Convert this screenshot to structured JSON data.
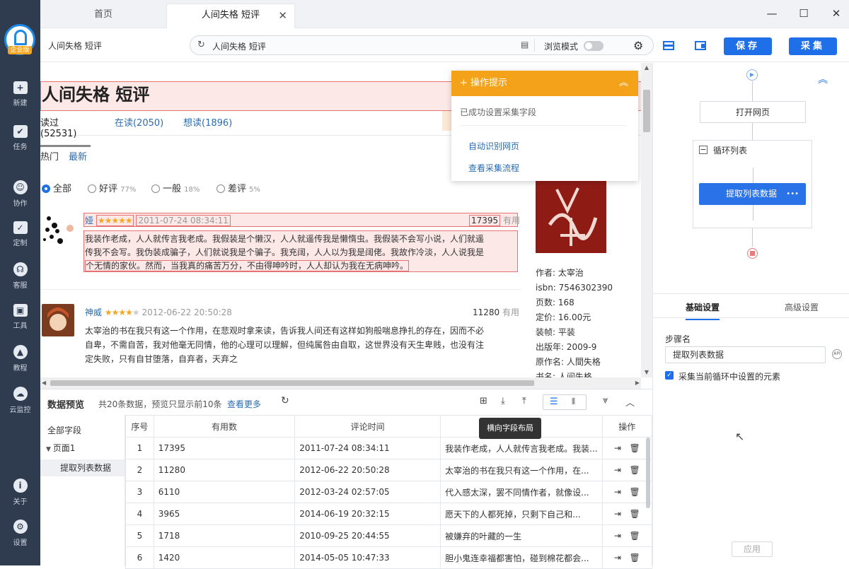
{
  "sidebar": {
    "logo_tag": "企业版",
    "items": [
      {
        "label": "新建",
        "icon": "plus-icon",
        "glyph": "+"
      },
      {
        "label": "任务",
        "icon": "flag-icon",
        "glyph": "✔"
      },
      {
        "label": "协作",
        "icon": "people-icon",
        "glyph": "☺"
      },
      {
        "label": "定制",
        "icon": "heart-check-icon",
        "glyph": "✓"
      },
      {
        "label": "客服",
        "icon": "headset-icon",
        "glyph": "☊"
      },
      {
        "label": "工具",
        "icon": "toolbox-icon",
        "glyph": "▣"
      },
      {
        "label": "教程",
        "icon": "graduation-cap-icon",
        "glyph": "▲"
      },
      {
        "label": "云监控",
        "icon": "cloud-pulse-icon",
        "glyph": "☁"
      },
      {
        "label": "关于",
        "icon": "info-icon",
        "glyph": "i"
      },
      {
        "label": "设置",
        "icon": "gear-icon",
        "glyph": "⚙"
      }
    ]
  },
  "tabs": [
    {
      "label": "首页"
    },
    {
      "label": "人间失格 短评"
    }
  ],
  "window": {
    "minimize": "—",
    "maximize": "☐",
    "close": "✕"
  },
  "toolbar": {
    "title": "人间失格 短评",
    "address": "人间失格 短评",
    "browse_mode": "浏览模式",
    "save_label": "保存",
    "collect_label": "采集"
  },
  "webpage": {
    "title": "人间失格 短评",
    "tabs": [
      "读过(52531)",
      "在读(2050)",
      "想读(1896)"
    ],
    "sort": [
      "热门",
      "最新"
    ],
    "filters": [
      {
        "label": "全部",
        "pct": ""
      },
      {
        "label": "好评",
        "pct": "77%"
      },
      {
        "label": "一般",
        "pct": "18%"
      },
      {
        "label": "差评",
        "pct": "5%"
      }
    ],
    "useful_suffix": "有用",
    "comments": [
      {
        "user": "娅",
        "stars": "★★★★★",
        "stars_off": "",
        "time": "2011-07-24 08:34:11",
        "useful": "17395",
        "text": [
          "我装作老成，人人就传言我老成。我假装是个懒汉，人人就遥传我是懒惰虫。我假装不会写小说，人们就遥",
          "传我不会写。我伪装成骗子，人们就说我是个骗子。我充阔，人人以为我是阔佬。我故作冷淡，人人说我是",
          "个无情的家伙。然而，当我真的痛苦万分，不由得呻吟时，人人却认为我在无病呻吟。"
        ]
      },
      {
        "user": "神威",
        "stars": "★★★★",
        "stars_off": "★",
        "time": "2012-06-22 20:50:28",
        "useful": "11280",
        "text": [
          "太宰治的书在我只有这一个作用，在悲观时拿来读，告诉我人间还有这样如狗般喘息挣扎的存在，因而不必",
          "自卑，不需自苦，我对他毫无同情，他的心理可以理解，但纯属咎由自取，这世界没有天生卑贱，也没有注",
          "定失败，只有自甘堕落，自弃者，天弃之"
        ]
      }
    ],
    "book_info": [
      "作者: 太宰治",
      "isbn: 7546302390",
      "页数: 168",
      "定价: 16.00元",
      "装帧: 平装",
      "出版年: 2009-9",
      "原作名: 人間失格",
      "书名: 人间失格"
    ],
    "tip": {
      "header": "操作提示",
      "message": "已成功设置采集字段",
      "link1": "自动识别网页",
      "link2": "查看采集流程"
    }
  },
  "preview": {
    "title": "数据预览",
    "summary": "共20条数据，预览只显示前10条",
    "more": "查看更多",
    "tooltip": "横向字段布局",
    "tree": {
      "root": "全部字段",
      "page": "页面1",
      "leaf": "提取列表数据"
    },
    "columns": [
      "序号",
      "有用数",
      "评论时间",
      "评论内容",
      "操作"
    ],
    "rows": [
      [
        "1",
        "17395",
        "2011-07-24 08:34:11",
        "我装作老成，人人就传言我老成。我装..."
      ],
      [
        "2",
        "11280",
        "2012-06-22 20:50:28",
        "太宰治的书在我只有这一个作用，在..."
      ],
      [
        "3",
        "6110",
        "2012-03-24 02:57:05",
        "代入感太深，罢不同情作者，就像设..."
      ],
      [
        "4",
        "3965",
        "2014-06-19 20:32:15",
        "愿天下的人都死掉，只剩下自己和..."
      ],
      [
        "5",
        "1718",
        "2010-09-25 20:44:55",
        "被嫌弃的叶藏的一生"
      ],
      [
        "6",
        "1420",
        "2014-05-05 10:47:33",
        "胆小鬼连幸福都害怕，碰到棉花都会..."
      ]
    ]
  },
  "flow": {
    "open_page": "打开网页",
    "loop": "循环列表",
    "extract": "提取列表数据",
    "more": "•••"
  },
  "settings": {
    "tab_basic": "基础设置",
    "tab_advanced": "高级设置",
    "step_name_label": "步骤名",
    "step_name_value": "提取列表数据",
    "checkbox_label": "采集当前循环中设置的元素",
    "apply": "应用"
  }
}
